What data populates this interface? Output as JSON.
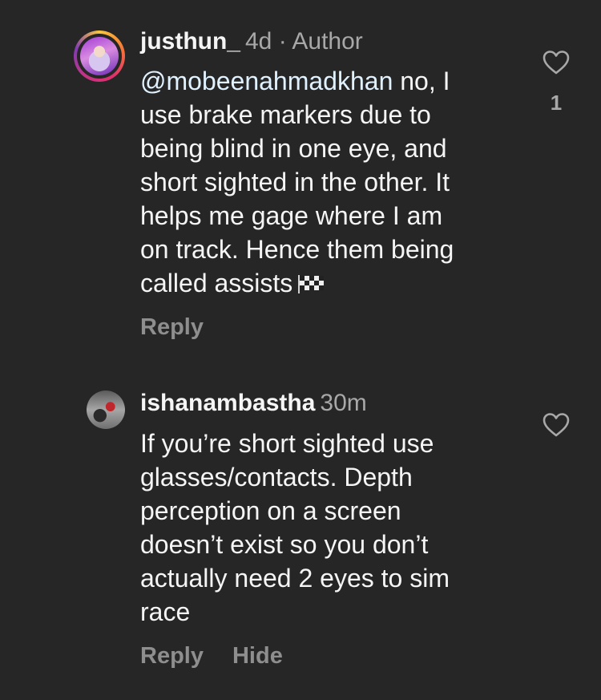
{
  "comments": [
    {
      "username": "justhun_",
      "meta": "4d · Author",
      "mention": "@mobeenahmadkhan",
      "text_lines": [
        "no, I",
        "use brake markers due to",
        "being blind in one eye, and",
        "short sighted in the other. It",
        "helps me gage where I am",
        "on track. Hence them being",
        "called assists"
      ],
      "emoji": "chequered-flag",
      "like_count": "1",
      "reply_label": "Reply"
    },
    {
      "username": "ishanambastha",
      "meta": "30m",
      "text_lines": [
        "If you’re short sighted use",
        "glasses/contacts. Depth",
        "perception on a screen",
        "doesn’t exist so you don’t",
        "actually need 2 eyes to sim",
        "race"
      ],
      "like_count": "",
      "reply_label": "Reply",
      "hide_label": "Hide"
    }
  ],
  "colors": {
    "background": "#262626",
    "text": "#f5f5f5",
    "meta": "#a8a8a8",
    "mention": "#e0f1ff",
    "action": "#8e8e8e"
  }
}
